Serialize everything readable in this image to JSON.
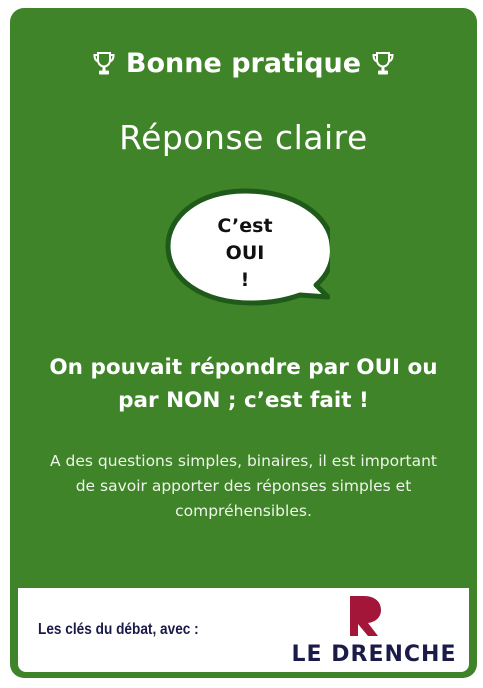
{
  "header": {
    "title": "Bonne pratique",
    "icon": "trophy-icon"
  },
  "subtitle": "Réponse claire",
  "bubble": {
    "line1": "C’est",
    "line2": "OUI",
    "line3": "!"
  },
  "headline": "On pouvait répondre par OUI ou par NON ; c’est fait !",
  "body": "A des questions simples, binaires, il est important de savoir apporter des réponses simples et compréhensibles.",
  "footer": {
    "label": "Les clés du débat, avec :",
    "logo_text": "LE DRENCHE"
  },
  "colors": {
    "card_green": "#3f8428",
    "bubble_border": "#1f5a1a",
    "logo_red": "#a3163a",
    "logo_navy": "#1b1b4a"
  }
}
